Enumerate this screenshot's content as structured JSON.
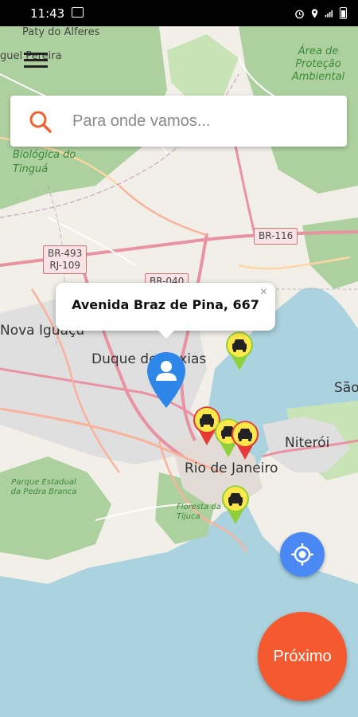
{
  "status_bar": {
    "time": "11:43",
    "icons": [
      "image-icon",
      "alarm-icon",
      "location-icon",
      "signal-icon",
      "battery-icon"
    ]
  },
  "search": {
    "placeholder": "Para onde vamos...",
    "icon": "search-icon",
    "icon_color": "#f2622e"
  },
  "popup": {
    "address": "Avenida Braz de Pina, 667",
    "close_label": "×"
  },
  "map": {
    "labels": {
      "paty_do_alferes": "Paty do Alferes",
      "miguel_pereira": "guel Pereira",
      "area_protecao": "Área de Proteção Ambiental",
      "biologica_tingua": "Biológica do Tinguá",
      "nova_iguacu": "Nova Iguaçu",
      "duque_de_caxias": "Duque de Caxias",
      "rio_de_janeiro": "Rio de Janeiro",
      "niteroi": "Niterói",
      "sao": "São",
      "parque_pedra_branca": "Parque Estadual da Pedra Branca",
      "floresta_tijuca": "Floresta da Tijuca"
    },
    "shields": {
      "br493": "BR-493",
      "rj109": "RJ-109",
      "br040": "BR-040",
      "br116": "BR-116"
    },
    "colors": {
      "water": "#aad3df",
      "land": "#f2efe9",
      "forest": "#add19e",
      "urban": "#e0dfdf",
      "motorway": "#e892a2",
      "trunk": "#f9b29c"
    }
  },
  "taxi_markers": [
    {
      "style": "green"
    },
    {
      "style": "red"
    },
    {
      "style": "green"
    },
    {
      "style": "red"
    },
    {
      "style": "green"
    }
  ],
  "buttons": {
    "next_label": "Próximo",
    "locate_icon": "my-location-icon",
    "locate_color": "#4a89f3",
    "next_color": "#f5592f"
  },
  "user_pin_color": "#2d86e8"
}
